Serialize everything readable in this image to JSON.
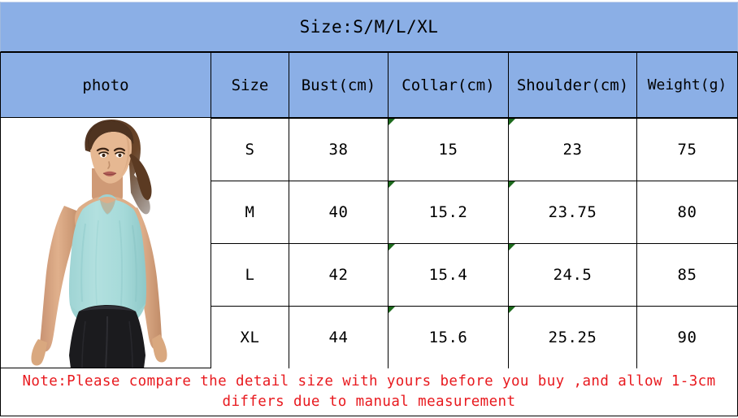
{
  "title": "Size:S/M/L/XL",
  "columns": [
    {
      "key": "photo",
      "label": "photo"
    },
    {
      "key": "size",
      "label": "Size"
    },
    {
      "key": "bust",
      "label": "Bust(cm)"
    },
    {
      "key": "collar",
      "label": "Collar(cm)"
    },
    {
      "key": "shoulder",
      "label": "Shoulder(cm)"
    },
    {
      "key": "weight",
      "label": "Weight(g)"
    }
  ],
  "rows": [
    {
      "size": "S",
      "bust": "38",
      "collar": "15",
      "shoulder": "23",
      "weight": "75"
    },
    {
      "size": "M",
      "bust": "40",
      "collar": "15.2",
      "shoulder": "23.75",
      "weight": "80"
    },
    {
      "size": "L",
      "bust": "42",
      "collar": "15.4",
      "shoulder": "24.5",
      "weight": "85"
    },
    {
      "size": "XL",
      "bust": "44",
      "collar": "15.6",
      "shoulder": "25.25",
      "weight": "90"
    }
  ],
  "photo": {
    "alt": "woman-wearing-mint-tank-top-and-black-leggings",
    "garment_color": "#a9dcdb",
    "legging_color": "#1b1b1e",
    "background": "#ffffff"
  },
  "note": {
    "line1": "Note:Please compare the detail size with yours before you buy ,and allow 1-3cm",
    "line2": "differs due to manual measurement"
  },
  "colors": {
    "header_blue": "#8bafe6",
    "border": "#000000",
    "note_red": "#e8191e",
    "comment_marker_green": "#1d6b1d"
  },
  "markers": {
    "comment_cells": [
      "collar",
      "shoulder"
    ]
  }
}
